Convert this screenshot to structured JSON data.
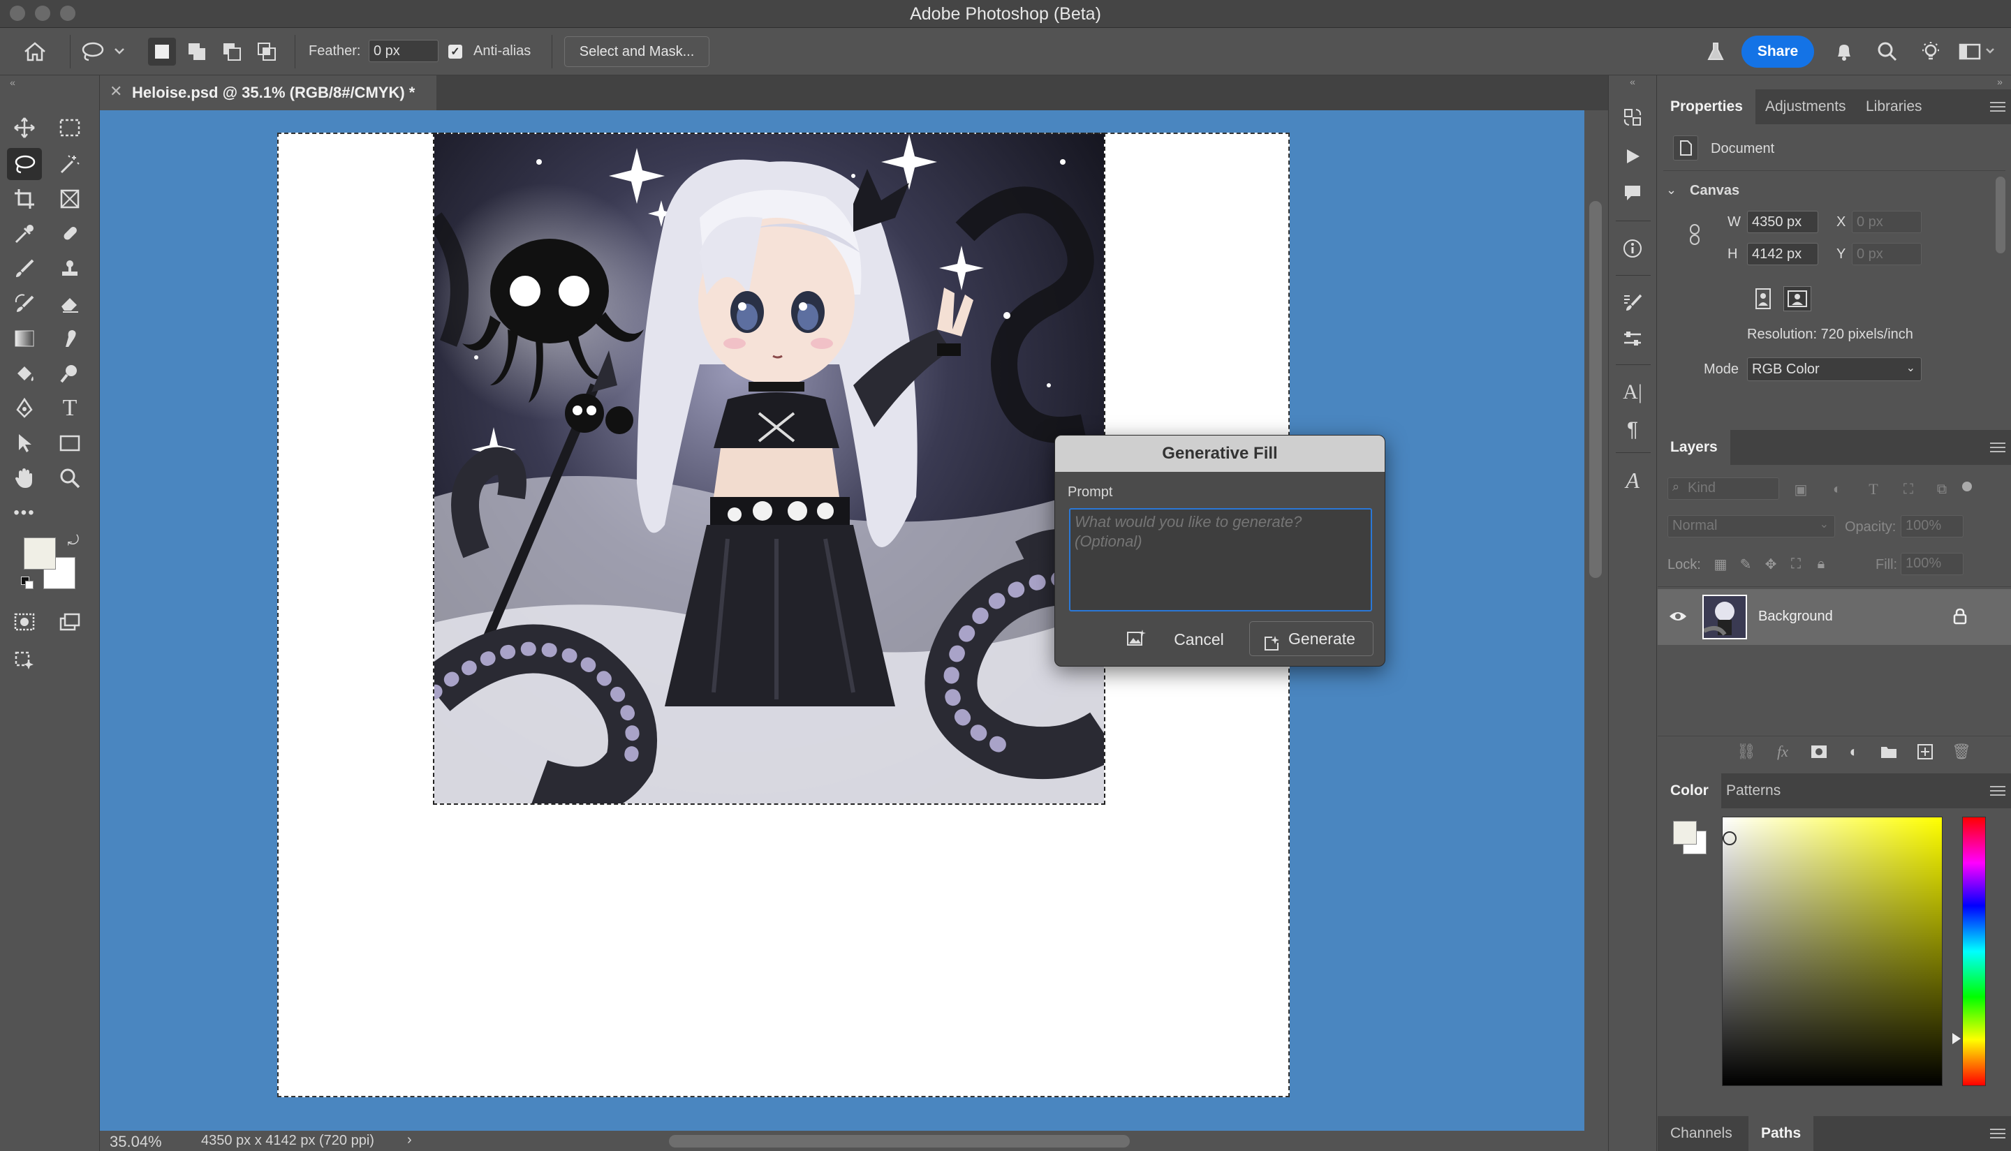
{
  "app_title": "Adobe Photoshop (Beta)",
  "options": {
    "feather_label": "Feather:",
    "feather_value": "0 px",
    "antialias_label": "Anti-alias",
    "select_mask_label": "Select and Mask...",
    "share_label": "Share"
  },
  "document_tab": {
    "title": "Heloise.psd @ 35.1% (RGB/8#/CMYK) *"
  },
  "status": {
    "zoom": "35.04%",
    "doc_size": "4350 px x 4142 px (720 ppi)"
  },
  "generative_fill": {
    "title": "Generative Fill",
    "prompt_label": "Prompt",
    "prompt_placeholder": "What would you like to generate? (Optional)",
    "cancel_label": "Cancel",
    "generate_label": "Generate"
  },
  "properties": {
    "tabs": [
      "Properties",
      "Adjustments",
      "Libraries"
    ],
    "document_label": "Document",
    "canvas_label": "Canvas",
    "w_label": "W",
    "w_value": "4350 px",
    "h_label": "H",
    "h_value": "4142 px",
    "x_label": "X",
    "x_value": "0 px",
    "y_label": "Y",
    "y_value": "0 px",
    "resolution": "Resolution: 720 pixels/inch",
    "mode_label": "Mode",
    "mode_value": "RGB Color"
  },
  "layers": {
    "tab": "Layers",
    "kind_placeholder": "Kind",
    "blend_mode": "Normal",
    "opacity_label": "Opacity:",
    "opacity_value": "100%",
    "lock_label": "Lock:",
    "fill_label": "Fill:",
    "fill_value": "100%",
    "items": [
      {
        "name": "Background"
      }
    ]
  },
  "color_panel": {
    "tabs": [
      "Color",
      "Patterns"
    ]
  },
  "bottom_panel": {
    "tabs": [
      "Channels",
      "Paths"
    ]
  },
  "colors": {
    "canvas_bg": "#4a86c0",
    "accent": "#1473e6"
  }
}
